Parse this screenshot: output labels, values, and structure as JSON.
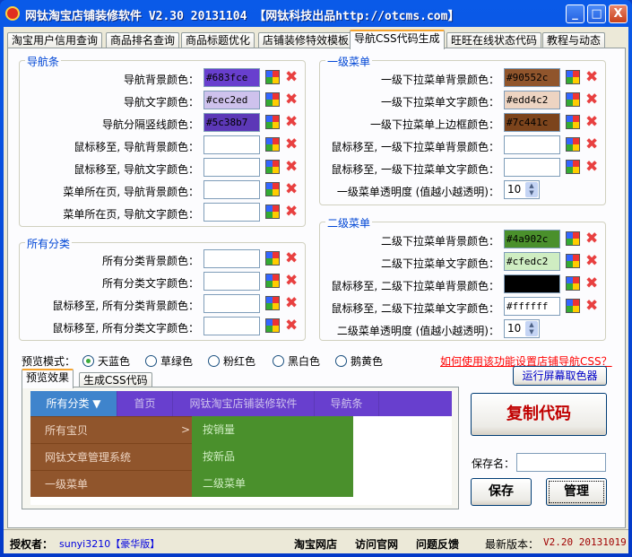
{
  "window": {
    "title": "网钛淘宝店铺装修软件 V2.30 20131104 【网钛科技出品http://otcms.com】",
    "min": "_",
    "max": "□",
    "close": "X"
  },
  "tabs": [
    "淘宝用户信用查询",
    "商品排名查询",
    "商品标题优化",
    "店铺装修特效模板",
    "导航CSS代码生成",
    "旺旺在线状态代码",
    "教程与动态"
  ],
  "active_tab": 4,
  "nav_group": {
    "title": "导航条",
    "rows": [
      {
        "label": "导航背景颜色：",
        "value": "#683fce",
        "color": "#683fce",
        "text": "#000000"
      },
      {
        "label": "导航文字颜色：",
        "value": "#cec2ed",
        "color": "#cec2ed",
        "text": "#000000"
      },
      {
        "label": "导航分隔竖线颜色：",
        "value": "#5c38b7",
        "color": "#5c38b7",
        "text": "#000000"
      },
      {
        "label": "鼠标移至, 导航背景颜色：",
        "value": "",
        "color": "#ffffff"
      },
      {
        "label": "鼠标移至, 导航文字颜色：",
        "value": "",
        "color": "#ffffff"
      },
      {
        "label": "菜单所在页, 导航背景颜色：",
        "value": "",
        "color": "#ffffff"
      },
      {
        "label": "菜单所在页, 导航文字颜色：",
        "value": "",
        "color": "#ffffff"
      }
    ]
  },
  "cat_group": {
    "title": "所有分类",
    "rows": [
      {
        "label": "所有分类背景颜色：",
        "value": "",
        "color": "#ffffff"
      },
      {
        "label": "所有分类文字颜色：",
        "value": "",
        "color": "#ffffff"
      },
      {
        "label": "鼠标移至, 所有分类背景颜色：",
        "value": "",
        "color": "#ffffff"
      },
      {
        "label": "鼠标移至, 所有分类文字颜色：",
        "value": "",
        "color": "#ffffff"
      }
    ]
  },
  "menu1_group": {
    "title": "一级菜单",
    "rows": [
      {
        "label": "一级下拉菜单背景颜色：",
        "value": "#90552c",
        "color": "#90552c"
      },
      {
        "label": "一级下拉菜单文字颜色：",
        "value": "#edd4c2",
        "color": "#edd4c2"
      },
      {
        "label": "一级下拉菜单上边框颜色：",
        "value": "#7c441c",
        "color": "#7c441c"
      },
      {
        "label": "鼠标移至, 一级下拉菜单背景颜色：",
        "value": "",
        "color": "#ffffff"
      },
      {
        "label": "鼠标移至, 一级下拉菜单文字颜色：",
        "value": "",
        "color": "#ffffff"
      }
    ],
    "opacity_label": "一级菜单透明度 (值越小越透明)：",
    "opacity": "10"
  },
  "menu2_group": {
    "title": "二级菜单",
    "rows": [
      {
        "label": "二级下拉菜单背景颜色：",
        "value": "#4a902c",
        "color": "#4a902c"
      },
      {
        "label": "二级下拉菜单文字颜色：",
        "value": "#cfedc2",
        "color": "#cfedc2"
      },
      {
        "label": "鼠标移至, 二级下拉菜单背景颜色：",
        "value": "",
        "color": "#000000"
      },
      {
        "label": "鼠标移至, 二级下拉菜单文字颜色：",
        "value": "#ffffff",
        "color": "#ffffff"
      }
    ],
    "opacity_label": "二级菜单透明度 (值越小越透明)：",
    "opacity": "10"
  },
  "preview_mode": {
    "label": "预览模式：",
    "options": [
      "天蓝色",
      "草绿色",
      "粉红色",
      "黑白色",
      "鹅黄色"
    ],
    "selected": 0
  },
  "help_link": "如何使用该功能设置店铺导航CSS？",
  "preview_tabs": [
    "预览效果",
    "生成CSS代码"
  ],
  "preview": {
    "nav": [
      "所有分类 ▼",
      "首页",
      "网钛淘宝店铺装修软件",
      "导航条"
    ],
    "menu1": [
      "所有宝贝",
      "网钛文章管理系统",
      "一级菜单"
    ],
    "arrow": ">",
    "menu2": [
      "按销量",
      "按新品",
      "二级菜单"
    ]
  },
  "buttons": {
    "picker": "运行屏幕取色器",
    "copy": "复制代码",
    "save_label": "保存名：",
    "save_value": "",
    "save": "保存",
    "manage": "管理"
  },
  "status": {
    "auth_label": "授权者：",
    "user": "sunyi3210【豪华版】",
    "links": [
      "淘宝网店",
      "访问官网",
      "问题反馈"
    ],
    "ver_label": "最新版本：",
    "version": "V2.20 20131019"
  }
}
